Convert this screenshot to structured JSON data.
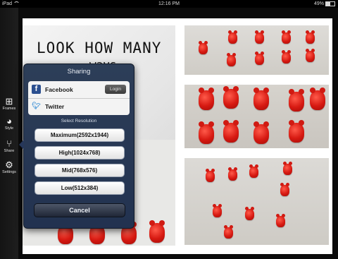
{
  "status_bar": {
    "device": "iPad",
    "time": "12:16 PM",
    "battery": "49%"
  },
  "toolbar": {
    "items": [
      {
        "label": "Frames",
        "icon": "frames-icon"
      },
      {
        "label": "Style",
        "icon": "palette-icon"
      },
      {
        "label": "Share",
        "icon": "share-icon"
      },
      {
        "label": "Settings",
        "icon": "gear-icon"
      }
    ]
  },
  "canvas": {
    "photo_text_line1": "LOOK HOW MANY",
    "photo_text_line2": "ways"
  },
  "sharing": {
    "title": "Sharing",
    "facebook_label": "Facebook",
    "login_label": "Login",
    "twitter_label": "Twitter",
    "resolution_header": "Select Resolution",
    "resolutions": [
      "Maximum(2592x1944)",
      "High(1024x768)",
      "Mid(768x576)",
      "Low(512x384)"
    ],
    "cancel_label": "Cancel"
  },
  "colors": {
    "popover_bg": "#223250",
    "facebook_blue": "#2b4f8f",
    "twitter_blue": "#4e9ad9",
    "candy_red": "#d71a12"
  }
}
